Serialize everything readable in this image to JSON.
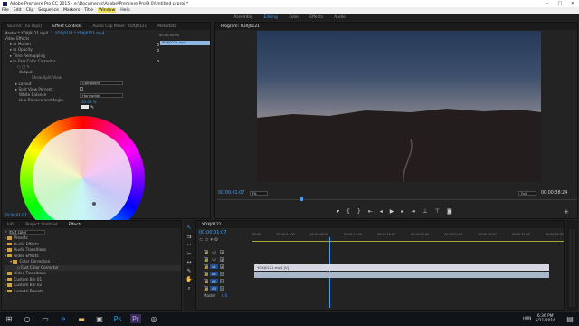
{
  "window": {
    "title": "Adobe Premiere Pro CC 2015 - e:\\Documents\\Adobe\\Premiere Pro\\9.0\\Untitled.prproj *"
  },
  "menu": [
    "File",
    "Edit",
    "Clip",
    "Sequence",
    "Markers",
    "Title",
    "Window",
    "Help"
  ],
  "workspaces": [
    "Assembly",
    "Editing",
    "Color",
    "Effects",
    "Audio"
  ],
  "active_workspace": "Editing",
  "source_panel": {
    "tabs": [
      "Source: (no clips)",
      "Effect Controls",
      "Audio Clip Mixer: YDXJ0121",
      "Metadata"
    ],
    "active_tab": "Effect Controls",
    "master": "Master * YDXJ0121.mp4",
    "clip": "YDXJ0121 * YDXJ0121.mp4",
    "timecode_ruler": "00:00:00:00",
    "clip_bar": "YDXJ0121.mp4",
    "video_effects_label": "Video Effects",
    "effects": [
      {
        "name": "Motion"
      },
      {
        "name": "Opacity"
      },
      {
        "name": "Time Remapping"
      },
      {
        "name": "Fast Color Corrector"
      }
    ],
    "output_label": "Output",
    "output_value": "Composite",
    "show_split_view": "Show Split View",
    "layout_label": "Layout",
    "layout_value": "Horizontal",
    "split_view_percent_label": "Split View Percent",
    "split_view_percent_value": "50.00 %",
    "white_balance_label": "White Balance",
    "hue_balance_label": "Hue Balance and Angle",
    "timecode": "00:00:01:07"
  },
  "program_monitor": {
    "title": "Program: YDXJ0121",
    "timecode_left": "00:00:01:07",
    "fit": "Fit",
    "quality": "Full",
    "timecode_right": "00:00:38:24"
  },
  "project_panel": {
    "tabs": [
      "Info",
      "Project: Untitled",
      "Effects"
    ],
    "active_tab": "Effects",
    "search_value": "fast color",
    "items": [
      {
        "label": "Presets",
        "indent": 0
      },
      {
        "label": "Audio Effects",
        "indent": 0
      },
      {
        "label": "Audio Transitions",
        "indent": 0
      },
      {
        "label": "Video Effects",
        "indent": 0
      },
      {
        "label": "Color Correction",
        "indent": 1
      },
      {
        "label": "Fast Color Corrector",
        "indent": 2
      },
      {
        "label": "Video Transitions",
        "indent": 0
      },
      {
        "label": "Custom Bin 01",
        "indent": 0
      },
      {
        "label": "Custom Bin 02",
        "indent": 0
      },
      {
        "label": "Lumetri Presets",
        "indent": 0
      }
    ]
  },
  "timeline": {
    "tab": "YDXJ0121",
    "timecode": "00:00:01:07",
    "ruler": [
      "00:00",
      "00:00:04:00",
      "00:00:08:00",
      "00:00:12:00",
      "00:00:16:00",
      "00:00:20:00",
      "00:00:24:00",
      "00:00:28:00",
      "00:00:32:00",
      "00:00:36:00"
    ],
    "tracks": [
      {
        "label": "V3"
      },
      {
        "label": "V2"
      },
      {
        "label": "V1"
      },
      {
        "label": "A1"
      },
      {
        "label": "A2"
      },
      {
        "label": "A3"
      }
    ],
    "clip_label": "YDXJ0121.mp4 [V]",
    "master_label": "Master",
    "master_value": "0.0"
  },
  "taskbar": {
    "time": "6:36 PM",
    "date": "5/21/2016",
    "lang": "HUN"
  },
  "colors": {
    "accent": "#4b9be8",
    "timeline_clip": "#d7d7e4",
    "menu_highlight": "#f1e05a"
  }
}
